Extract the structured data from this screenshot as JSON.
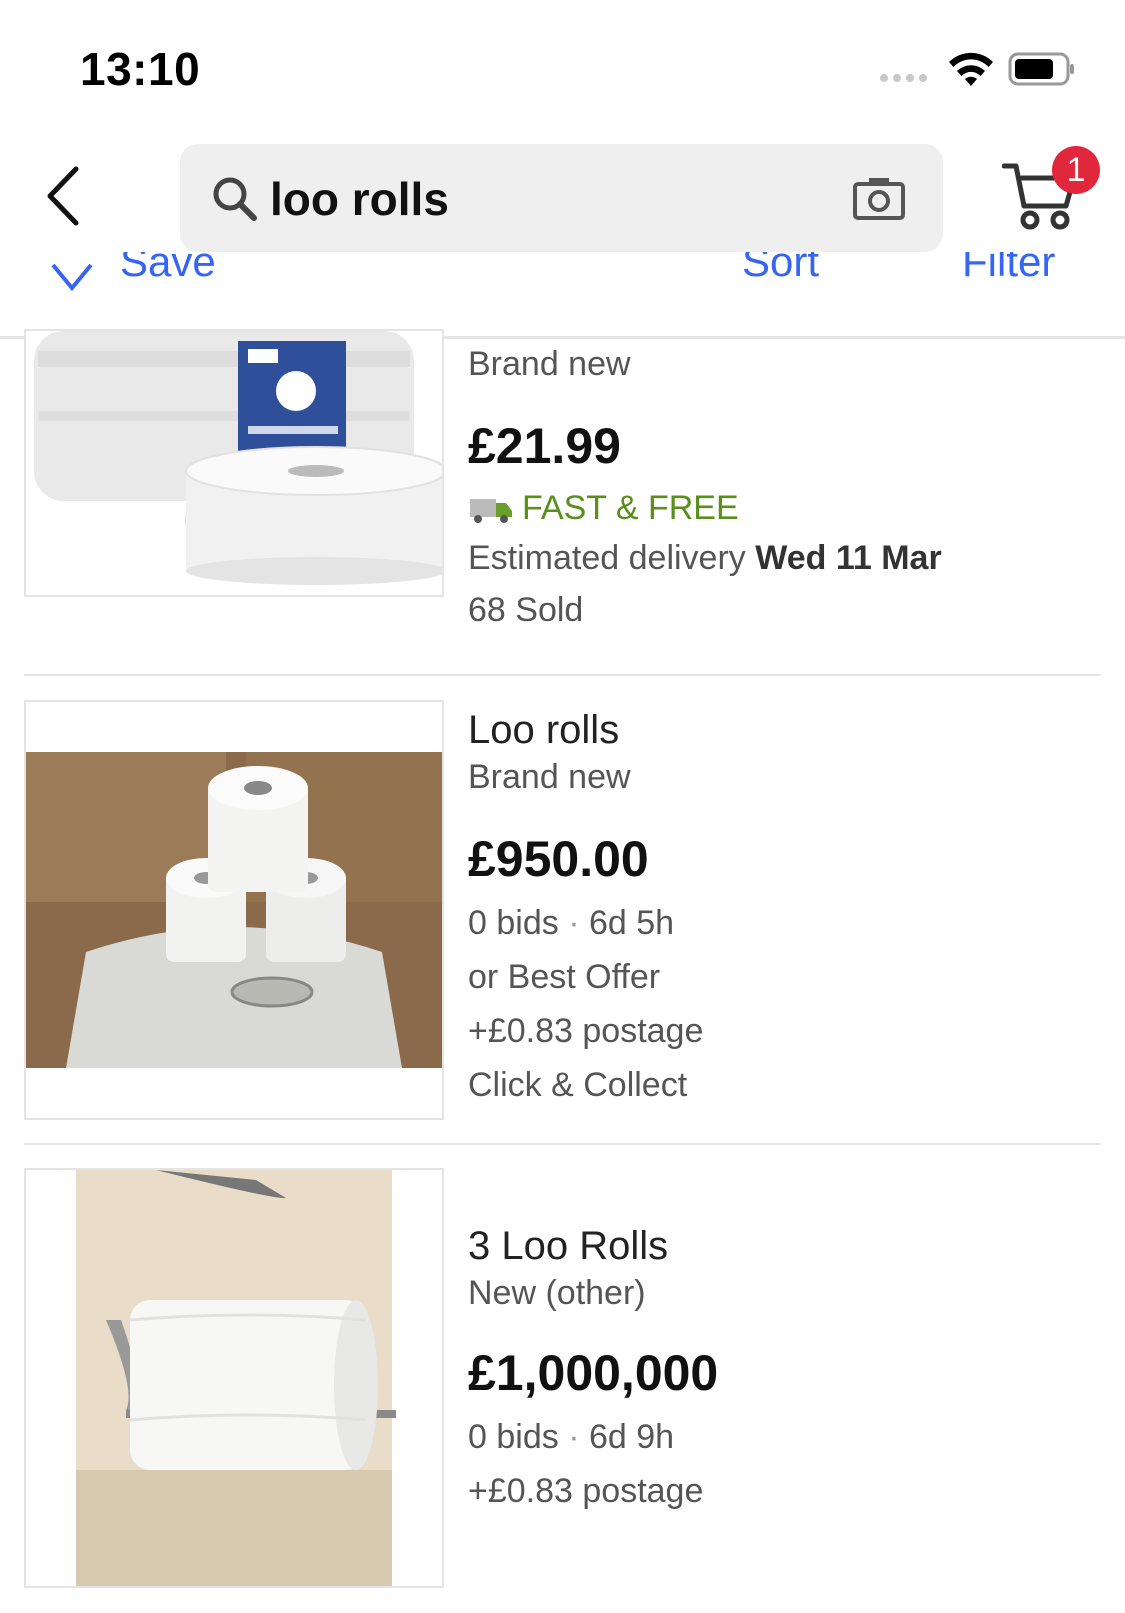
{
  "status_bar": {
    "time": "13:10"
  },
  "header": {
    "search_query": "loo rolls",
    "cart_count": "1"
  },
  "action_bar": {
    "save": "Save",
    "sort": "Sort",
    "filter": "Filter"
  },
  "listings": [
    {
      "condition": "Brand new",
      "price": "£21.99",
      "shipping": "FAST & FREE",
      "delivery_prefix": "Estimated delivery",
      "delivery_date": "Wed 11 Mar",
      "sold": "68 Sold"
    },
    {
      "title": "Loo rolls",
      "condition": "Brand new",
      "price": "£950.00",
      "bids": "0 bids",
      "time_left": "6d 5h",
      "offer": "or Best Offer",
      "postage": "+£0.83 postage",
      "collect": "Click & Collect"
    },
    {
      "title": "3 Loo Rolls",
      "condition": "New (other)",
      "price": "£1,000,000",
      "bids": "0 bids",
      "time_left": "6d 9h",
      "postage": "+£0.83 postage"
    }
  ],
  "colors": {
    "accent": "#3665f3",
    "badge": "#e0273b",
    "free_shipping": "#5a8f1c"
  }
}
